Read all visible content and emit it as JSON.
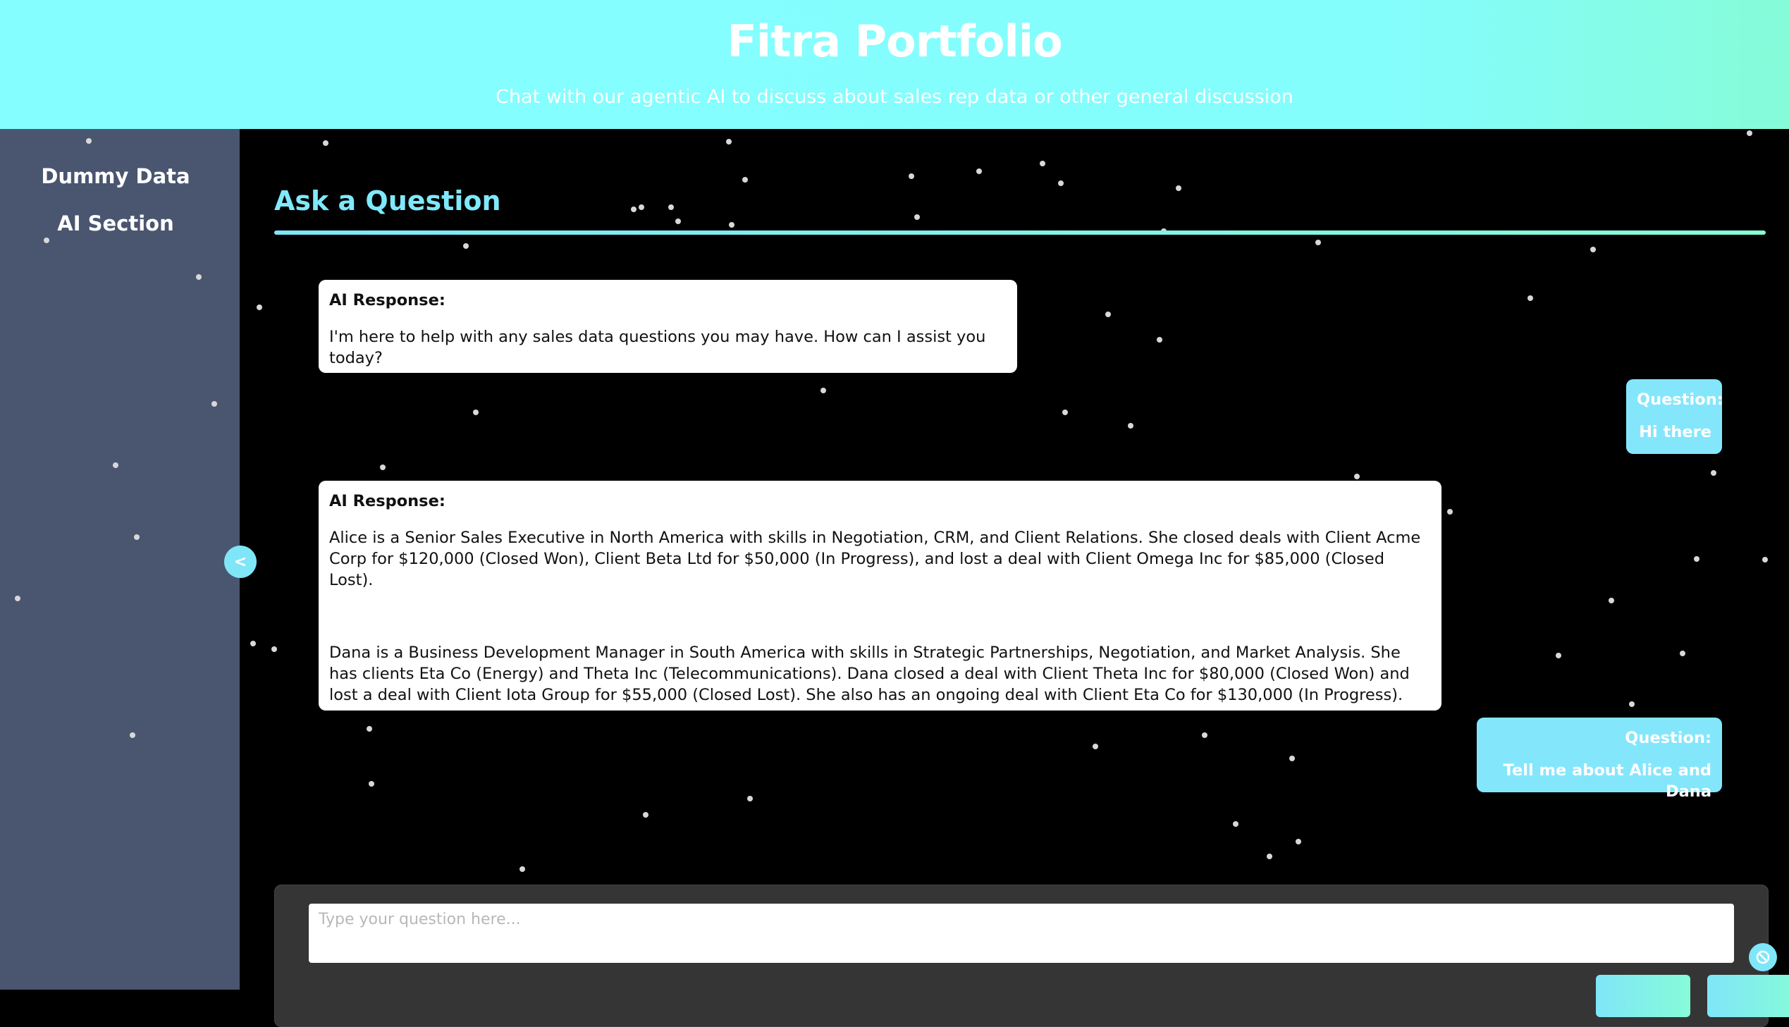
{
  "header": {
    "title": "Fitra Portfolio",
    "subtitle": "Chat with our agentic AI to discuss about sales rep data or other general discussion"
  },
  "sidebar": {
    "items": [
      {
        "label": "Dummy Data"
      },
      {
        "label": "AI Section"
      }
    ],
    "collapse_label": "<"
  },
  "main": {
    "section_title": "Ask a Question",
    "messages": [
      {
        "role": "ai",
        "label": "AI Response:",
        "paragraphs": [
          "I'm here to help with any sales data questions you may have. How can I assist you today?"
        ]
      },
      {
        "role": "user",
        "label": "Question:",
        "text": "Hi there"
      },
      {
        "role": "ai",
        "label": "AI Response:",
        "paragraphs": [
          "Alice is a Senior Sales Executive in North America with skills in Negotiation, CRM, and Client Relations. She closed deals with Client Acme Corp for $120,000 (Closed Won), Client Beta Ltd for $50,000 (In Progress), and lost a deal with Client Omega Inc for $85,000 (Closed Lost).",
          "Dana is a Business Development Manager in South America with skills in Strategic Partnerships, Negotiation, and Market Analysis. She has clients Eta Co (Energy) and Theta Inc (Telecommunications). Dana closed a deal with Client Theta Inc for $80,000 (Closed Won) and lost a deal with Client Iota Group for $55,000 (Closed Lost). She also has an ongoing deal with Client Eta Co for $130,000 (In Progress)."
        ]
      },
      {
        "role": "user",
        "label": "Question:",
        "text": "Tell me about Alice and Dana"
      }
    ],
    "input": {
      "placeholder": "Type your question here..."
    }
  },
  "colors": {
    "accent": "#7fe6f8",
    "accent_green": "#86fbd8",
    "sidebar_bg": "#4a5670",
    "main_bg": "#000000",
    "user_bubble": "#84e6fb"
  }
}
